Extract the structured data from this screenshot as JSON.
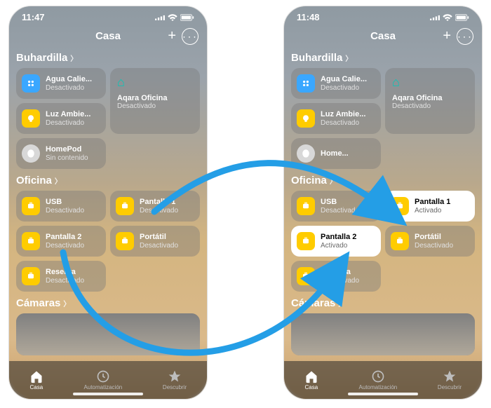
{
  "left": {
    "time": "11:47",
    "title": "Casa",
    "rooms": [
      {
        "name": "Buhardilla",
        "tiles": [
          {
            "kind": "small",
            "icon": "ac",
            "name": "Agua Calie...",
            "state": "Desactivado",
            "on": false
          },
          {
            "kind": "wide",
            "icon": "hub",
            "name": "Aqara Oficina",
            "state": "Desactivado",
            "on": false
          },
          {
            "kind": "small",
            "icon": "bulb",
            "name": "Luz Ambie...",
            "state": "Desactivado",
            "on": false
          },
          {
            "kind": "small",
            "icon": "homepod",
            "name": "HomePod",
            "state": "Sin contenido",
            "on": false
          }
        ]
      },
      {
        "name": "Oficina",
        "tiles": [
          {
            "kind": "small",
            "icon": "plug",
            "name": "USB",
            "state": "Desactivado",
            "on": false
          },
          {
            "kind": "small",
            "icon": "plug",
            "name": "Pantalla 1",
            "state": "Desactivado",
            "on": false
          },
          {
            "kind": "small",
            "icon": "plug",
            "name": "Pantalla 2",
            "state": "Desactivado",
            "on": false
          },
          {
            "kind": "small",
            "icon": "plug",
            "name": "Portátil",
            "state": "Desactivado",
            "on": false
          },
          {
            "kind": "small",
            "icon": "plug",
            "name": "Reserva",
            "state": "Desactivado",
            "on": false
          }
        ]
      }
    ],
    "cameras_label": "Cámaras",
    "tabs": [
      "Casa",
      "Automatización",
      "Descubrir"
    ]
  },
  "right": {
    "time": "11:48",
    "title": "Casa",
    "rooms": [
      {
        "name": "Buhardilla",
        "tiles": [
          {
            "kind": "small",
            "icon": "ac",
            "name": "Agua Calie...",
            "state": "Desactivado",
            "on": false
          },
          {
            "kind": "wide",
            "icon": "hub",
            "name": "Aqara Oficina",
            "state": "Desactivado",
            "on": false
          },
          {
            "kind": "small",
            "icon": "bulb",
            "name": "Luz Ambie...",
            "state": "Desactivado",
            "on": false
          },
          {
            "kind": "small",
            "icon": "homepod",
            "name": "Home...",
            "state": "",
            "on": false
          }
        ]
      },
      {
        "name": "Oficina",
        "tiles": [
          {
            "kind": "small",
            "icon": "plug",
            "name": "USB",
            "state": "Desactivado",
            "on": false
          },
          {
            "kind": "small",
            "icon": "plug",
            "name": "Pantalla 1",
            "state": "Activado",
            "on": true
          },
          {
            "kind": "small",
            "icon": "plug",
            "name": "Pantalla 2",
            "state": "Activado",
            "on": true
          },
          {
            "kind": "small",
            "icon": "plug",
            "name": "Portátil",
            "state": "Desactivado",
            "on": false
          },
          {
            "kind": "small",
            "icon": "plug",
            "name": "Reserva",
            "state": "Desactivado",
            "on": false
          }
        ]
      }
    ],
    "cameras_label": "Cámaras",
    "tabs": [
      "Casa",
      "Automatización",
      "Descubrir"
    ]
  }
}
